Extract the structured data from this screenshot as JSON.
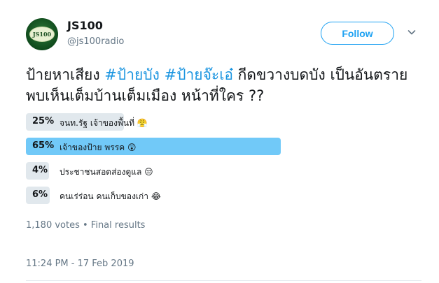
{
  "author": {
    "avatar_text": "JS100",
    "display_name": "JS100",
    "handle": "@js100radio"
  },
  "follow_label": "Follow",
  "tweet": {
    "part1": "ป้ายหาเสียง ",
    "hashtag1": "#ป้ายบัง",
    "space": " ",
    "hashtag2": "#ป้ายจ๊ะเอ๋",
    "part2": " กีดขวางบดบัง เป็นอันตราย พบเห็นเต็มบ้านเต็มเมือง หน้าที่ใคร ??"
  },
  "poll": {
    "options": [
      {
        "pct_label": "25%",
        "value": 25,
        "label": "จนท.รัฐ เจ้าของพื้นที่ 😤",
        "winner": false
      },
      {
        "pct_label": "65%",
        "value": 65,
        "label": "เจ้าของป้าย พรรค 😲",
        "winner": true
      },
      {
        "pct_label": "4%",
        "value": 4,
        "label": "ประชาชนสอดส่องดูแล 😒",
        "winner": false
      },
      {
        "pct_label": "6%",
        "value": 6,
        "label": "คนเร่ร่อน คนเก็บของเก่า 😂",
        "winner": false
      }
    ],
    "summary": "1,180 votes • Final results"
  },
  "timestamp": "11:24 PM - 17 Feb 2019",
  "colors": {
    "accent": "#1da1f2",
    "winner_bar": "#71c9f8",
    "bar": "#e1e8ed"
  }
}
